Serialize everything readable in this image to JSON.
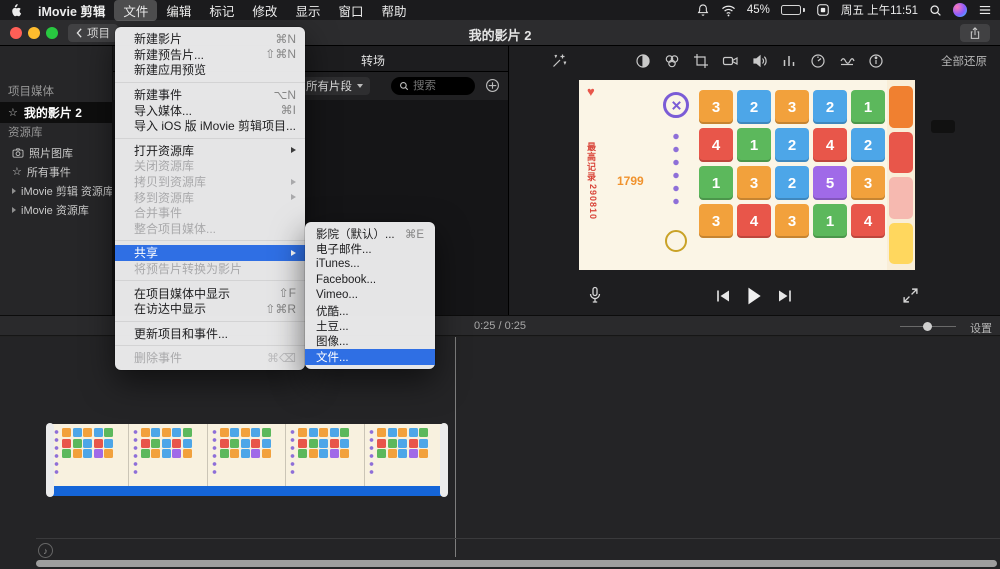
{
  "icons": {
    "heart": "♥",
    "star": "☆",
    "music_note": "♪"
  },
  "menubar": {
    "items": [
      "iMovie 剪辑",
      "文件",
      "编辑",
      "标记",
      "修改",
      "显示",
      "窗口",
      "帮助"
    ],
    "status": {
      "battery_pct": "45%",
      "clock": "周五 上午11:51"
    }
  },
  "window": {
    "title": "我的影片 2",
    "back_label": "项目"
  },
  "sidebar": {
    "project_media_label": "项目媒体",
    "selected_project": "我的影片 2",
    "libraries_label": "资源库",
    "items": [
      {
        "label": "照片图库"
      },
      {
        "label": "所有事件"
      },
      {
        "label": "iMovie 剪辑 资源库"
      },
      {
        "label": "iMovie 资源库"
      }
    ]
  },
  "file_menu": {
    "items": [
      {
        "label": "新建影片",
        "shortcut": "⌘N"
      },
      {
        "label": "新建预告片...",
        "shortcut": "⇧⌘N"
      },
      {
        "label": "新建应用预览",
        "shortcut": ""
      },
      {
        "label": "新建事件",
        "shortcut": "⌥N"
      },
      {
        "label": "导入媒体...",
        "shortcut": "⌘I"
      },
      {
        "label": "导入 iOS 版 iMovie 剪辑项目...",
        "shortcut": ""
      },
      {
        "label": "打开资源库",
        "shortcut": ""
      },
      {
        "label": "关闭资源库",
        "shortcut": ""
      },
      {
        "label": "拷贝到资源库",
        "shortcut": ""
      },
      {
        "label": "移到资源库",
        "shortcut": ""
      },
      {
        "label": "合并事件",
        "shortcut": ""
      },
      {
        "label": "整合项目媒体...",
        "shortcut": ""
      },
      {
        "label": "共享",
        "shortcut": ""
      },
      {
        "label": "将预告片转换为影片",
        "shortcut": ""
      },
      {
        "label": "在项目媒体中显示",
        "shortcut": "⇧F"
      },
      {
        "label": "在访达中显示",
        "shortcut": "⇧⌘R"
      },
      {
        "label": "更新项目和事件...",
        "shortcut": ""
      },
      {
        "label": "删除事件",
        "shortcut": "⌘⌫"
      }
    ]
  },
  "share_menu": {
    "items": [
      {
        "label": "影院（默认）...",
        "shortcut": "⌘E"
      },
      {
        "label": "电子邮件...",
        "shortcut": ""
      },
      {
        "label": "iTunes...",
        "shortcut": ""
      },
      {
        "label": "Facebook...",
        "shortcut": ""
      },
      {
        "label": "Vimeo...",
        "shortcut": ""
      },
      {
        "label": "优酷...",
        "shortcut": ""
      },
      {
        "label": "土豆...",
        "shortcut": ""
      },
      {
        "label": "图像...",
        "shortcut": ""
      },
      {
        "label": "文件...",
        "shortcut": ""
      }
    ]
  },
  "browser": {
    "visible_tab": "转场",
    "clip_filter": "所有片段",
    "search_placeholder": "搜索"
  },
  "preview": {
    "reset_all_label": "全部还原",
    "game": {
      "high_score_label": "最高记录",
      "high_score": "290810",
      "score": "1799",
      "tiles": [
        [
          3,
          2,
          3,
          2,
          1
        ],
        [
          4,
          1,
          2,
          4,
          2
        ],
        [
          1,
          3,
          2,
          5,
          3
        ],
        [
          3,
          4,
          3,
          1,
          4
        ]
      ],
      "tile_colors": {
        "1": "#5cb85c",
        "2": "#4da6e8",
        "3": "#f2a13c",
        "4": "#e8564a",
        "5": "#a06ae8"
      }
    }
  },
  "timeline": {
    "time_display": "0:25 / 0:25",
    "settings_label": "设置"
  }
}
